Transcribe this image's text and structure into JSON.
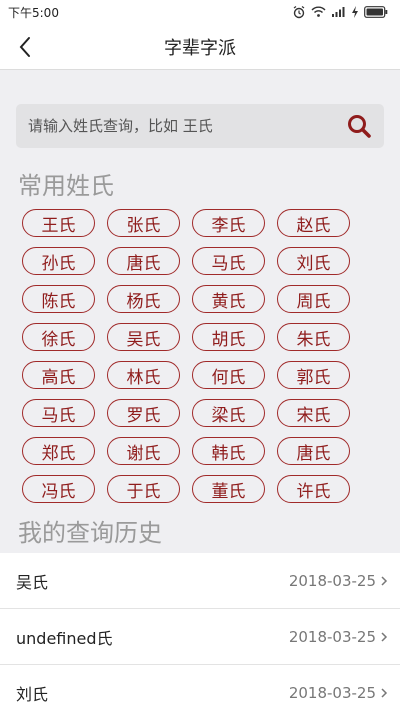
{
  "status_bar": {
    "time": "下午5:00"
  },
  "nav": {
    "title": "字辈字派"
  },
  "search": {
    "placeholder": "请输入姓氏查询，比如 王氏"
  },
  "common": {
    "title": "常用姓氏",
    "surnames": [
      "王氏",
      "张氏",
      "李氏",
      "赵氏",
      "孙氏",
      "唐氏",
      "马氏",
      "刘氏",
      "陈氏",
      "杨氏",
      "黄氏",
      "周氏",
      "徐氏",
      "吴氏",
      "胡氏",
      "朱氏",
      "高氏",
      "林氏",
      "何氏",
      "郭氏",
      "马氏",
      "罗氏",
      "梁氏",
      "宋氏",
      "郑氏",
      "谢氏",
      "韩氏",
      "唐氏",
      "冯氏",
      "于氏",
      "董氏",
      "许氏"
    ]
  },
  "history": {
    "title": "我的查询历史",
    "items": [
      {
        "name": "吴氏",
        "date": "2018-03-25"
      },
      {
        "name": "undefined氏",
        "date": "2018-03-25"
      },
      {
        "name": "刘氏",
        "date": "2018-03-25"
      }
    ]
  },
  "colors": {
    "accent": "#8f1c1c",
    "background": "#efeff2"
  }
}
